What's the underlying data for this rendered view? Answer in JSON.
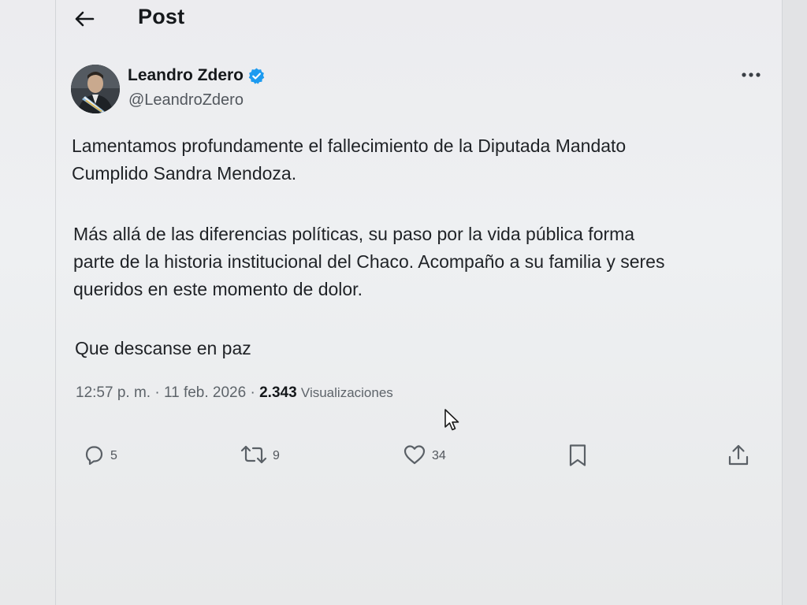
{
  "header": {
    "back_icon": "arrow-left-icon",
    "title": "Post"
  },
  "author": {
    "name": "Leandro Zdero",
    "handle": "@LeandroZdero",
    "verified": true,
    "verified_color": "#1d9bf0",
    "avatar_icon": "avatar-photo"
  },
  "tweet": {
    "paragraphs": [
      "Lamentamos profundamente el fallecimiento de la Diputada Mandato Cumplido Sandra Mendoza.",
      "Más allá de las diferencias políticas, su paso por la vida pública forma parte de la historia institucional del Chaco. Acompaño a su familia y seres queridos en este momento de dolor.",
      "Que descanse en paz"
    ],
    "line_breaks": {
      "p1": [
        "Lamentamos profundamente el fallecimiento de la Diputada Mandato",
        "Cumplido Sandra Mendoza."
      ],
      "p2": [
        "Más allá de las diferencias políticas, su paso por la vida pública forma",
        "parte de la historia institucional del Chaco. Acompaño a su familia y seres",
        "queridos en este momento de dolor."
      ]
    }
  },
  "meta": {
    "time": "12:57 p. m.",
    "separator": " · ",
    "date": "11 feb. 2026",
    "views_count": "2.343",
    "views_label": "Visualizaciones"
  },
  "actions": {
    "reply": {
      "icon": "reply-icon",
      "count": "5"
    },
    "retweet": {
      "icon": "retweet-icon",
      "count": "9"
    },
    "like": {
      "icon": "heart-icon",
      "count": "34"
    },
    "bookmark": {
      "icon": "bookmark-icon"
    },
    "share": {
      "icon": "share-icon"
    }
  },
  "colors": {
    "text": "#1f2226",
    "muted": "#5e646a",
    "background": "#eceef0",
    "accent": "#1d9bf0"
  }
}
